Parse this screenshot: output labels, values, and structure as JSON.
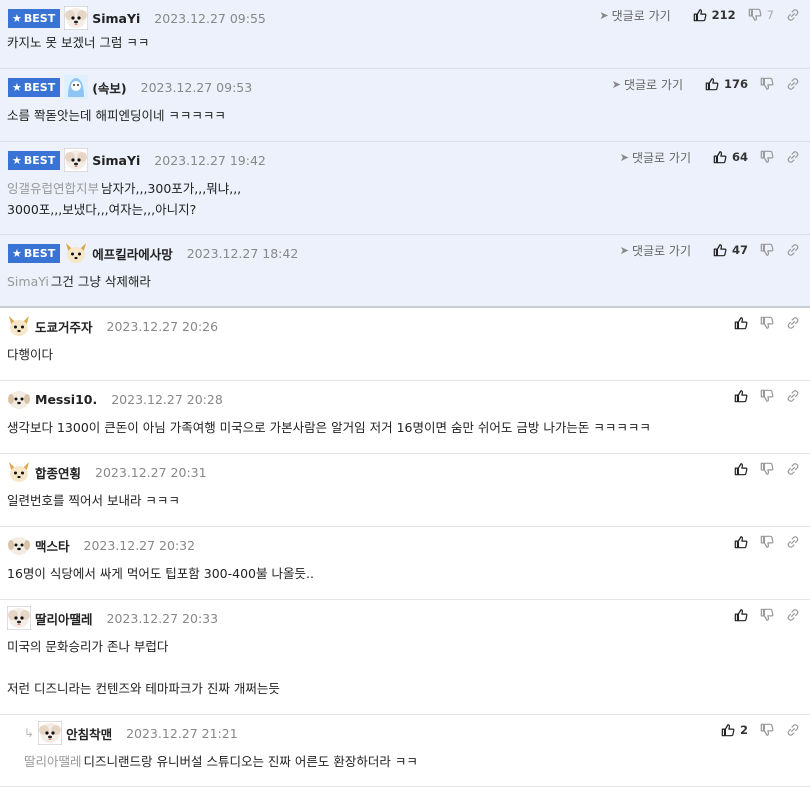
{
  "common": {
    "best_label": "BEST",
    "reply_label": "댓글로 가기"
  },
  "comments": [
    {
      "best": true,
      "nick": "SimaYi",
      "date": "2023.12.27 09:55",
      "avatar": "bichon-avatar",
      "lines": [
        "카지노 못 보겠너 그럼 ㅋㅋ"
      ],
      "quote": "",
      "up": "212",
      "down": "7"
    },
    {
      "best": true,
      "nick": "(속보)",
      "date": "2023.12.27 09:53",
      "avatar": "blue-character-avatar",
      "lines": [
        "소름 쫙돋앗는데 해피엔딩이네 ㅋㅋㅋㅋㅋ"
      ],
      "quote": "",
      "up": "176",
      "down": ""
    },
    {
      "best": true,
      "nick": "SimaYi",
      "date": "2023.12.27 19:42",
      "avatar": "bichon-avatar",
      "lines": [
        "남자가,,,300포가,,,뭐냐,,,",
        "3000포,,,보냈다,,,여자는,,,아니지?"
      ],
      "quote": "잉갤유럽연합지부",
      "up": "64",
      "down": ""
    },
    {
      "best": true,
      "nick": "에프킬라에사망",
      "date": "2023.12.27 18:42",
      "avatar": "fox-avatar",
      "lines": [
        "그건 그냥 삭제해라"
      ],
      "quote": "SimaYi",
      "up": "47",
      "down": ""
    },
    {
      "best": false,
      "nick": "도쿄거주자",
      "date": "2023.12.27 20:26",
      "avatar": "fox-avatar",
      "lines": [
        "다행이다"
      ],
      "quote": "",
      "up": "",
      "down": ""
    },
    {
      "best": false,
      "nick": "Messi10.",
      "date": "2023.12.27 20:28",
      "avatar": "puppy-avatar",
      "lines": [
        "생각보다 1300이 큰돈이 아님 가족여행 미국으로 가본사람은 알거임 저거 16명이면 숨만 쉬어도 금방 나가는돈 ㅋㅋㅋㅋㅋ"
      ],
      "quote": "",
      "up": "",
      "down": ""
    },
    {
      "best": false,
      "nick": "합종연횡",
      "date": "2023.12.27 20:31",
      "avatar": "fox-avatar",
      "lines": [
        "일련번호를 찍어서 보내라 ㅋㅋㅋ"
      ],
      "quote": "",
      "up": "",
      "down": ""
    },
    {
      "best": false,
      "nick": "맥스타",
      "date": "2023.12.27 20:32",
      "avatar": "puppy-avatar",
      "lines": [
        "16명이 식당에서 싸게 먹어도 팁포함 300-400불 나올듯.."
      ],
      "quote": "",
      "up": "",
      "down": ""
    },
    {
      "best": false,
      "nick": "딸리아땔레",
      "date": "2023.12.27 20:33",
      "avatar": "bichon-avatar",
      "lines": [
        "미국의 문화승리가 존나 부럽다",
        "",
        "저런 디즈니라는 컨텐즈와 테마파크가 진짜 개쩌는듯"
      ],
      "quote": "",
      "up": "",
      "down": ""
    },
    {
      "best": false,
      "reply": true,
      "nick": "안침착맨",
      "date": "2023.12.27 21:21",
      "avatar": "bichon-avatar",
      "lines": [
        "디즈니랜드랑 유니버설 스튜디오는 진짜 어른도 환장하더라 ㅋㅋ"
      ],
      "quote": "딸리아땔레",
      "up": "2",
      "down": ""
    }
  ]
}
